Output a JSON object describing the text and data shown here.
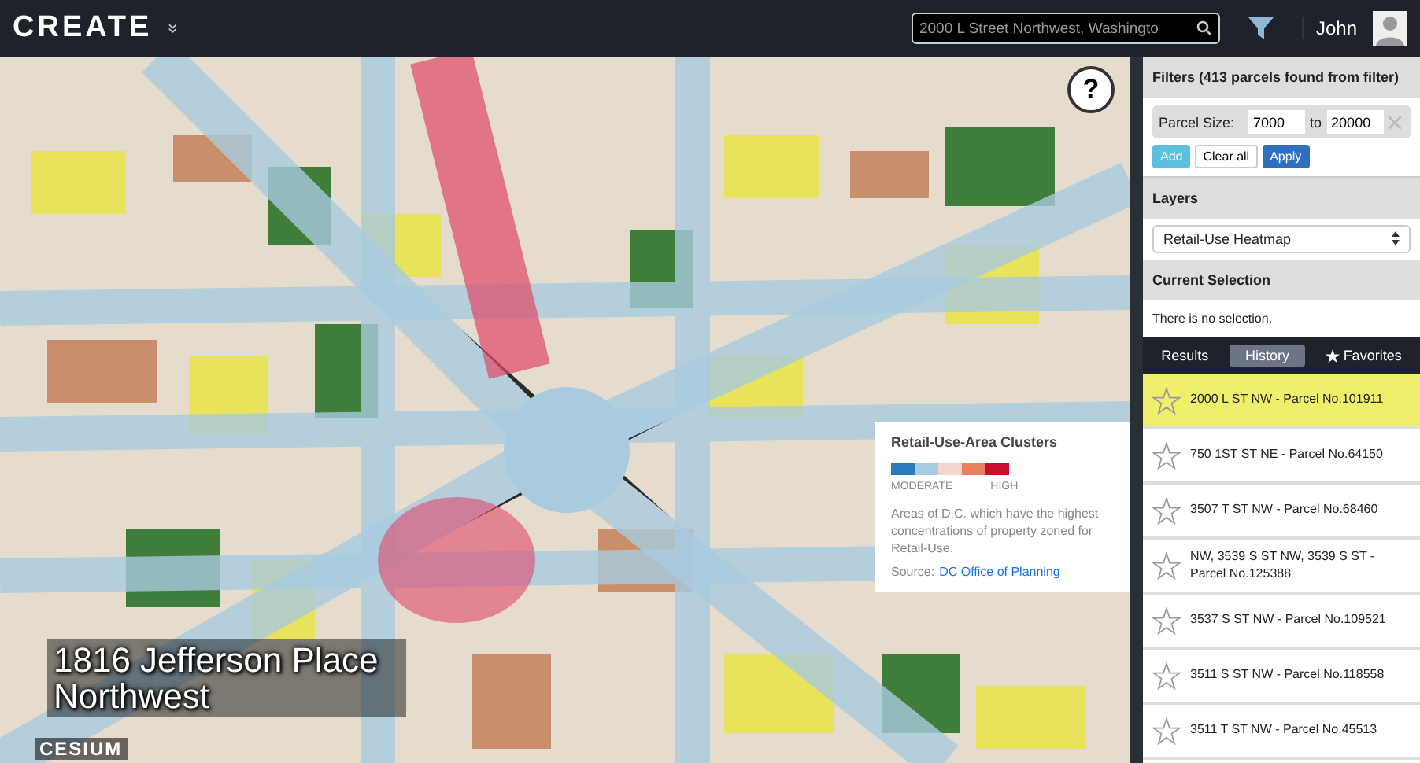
{
  "header": {
    "logo": "CREATE",
    "logo_menu": "»",
    "search": {
      "value": "2000 L Street Northwest, Washingto"
    },
    "user": "John"
  },
  "map": {
    "help": "?",
    "place_label": "1816 Jefferson Place Northwest",
    "attribution": "CESIUM",
    "legend": {
      "title": "Retail-Use-Area Clusters",
      "swatches": [
        {
          "color": "#2b7bba"
        },
        {
          "color": "#a6cbe3"
        },
        {
          "color": "#f2d6cc"
        },
        {
          "color": "#ec7e5f"
        },
        {
          "color": "#c8102e"
        }
      ],
      "low_label": "MODERATE",
      "high_label": "HIGH",
      "description": "Areas of D.C. which have the highest concentrations of property zoned for Retail-Use.",
      "source_label": "Source:",
      "source_link": "DC Office of Planning"
    }
  },
  "sidebar": {
    "filters": {
      "title": "Filters (413 parcels found from filter)",
      "label": "Parcel Size:",
      "from": "7000",
      "to_label": "to",
      "to": "20000",
      "buttons": [
        "Add",
        "Clear all",
        "Apply"
      ]
    },
    "layers": {
      "title": "Layers",
      "value": "Retail-Use Heatmap"
    },
    "selection": {
      "title": "Current Selection",
      "text": "There is no selection."
    },
    "tabs": [
      {
        "label": "Results",
        "selected": false,
        "star": false
      },
      {
        "label": "History",
        "selected": true,
        "star": false
      },
      {
        "label": "Favorites",
        "selected": false,
        "star": true
      }
    ],
    "items": [
      {
        "text": "2000 L ST NW - Parcel No.101911",
        "selected": true
      },
      {
        "text": "750 1ST ST NE - Parcel No.64150",
        "selected": false
      },
      {
        "text": "3507 T ST NW - Parcel No.68460",
        "selected": false
      },
      {
        "text": "NW, 3539 S ST NW, 3539 S ST - Parcel No.125388",
        "selected": false
      },
      {
        "text": "3537 S ST NW - Parcel No.109521",
        "selected": false
      },
      {
        "text": "3511 S ST NW - Parcel No.118558",
        "selected": false
      },
      {
        "text": "3511 T ST NW - Parcel No.45513",
        "selected": false
      }
    ]
  }
}
